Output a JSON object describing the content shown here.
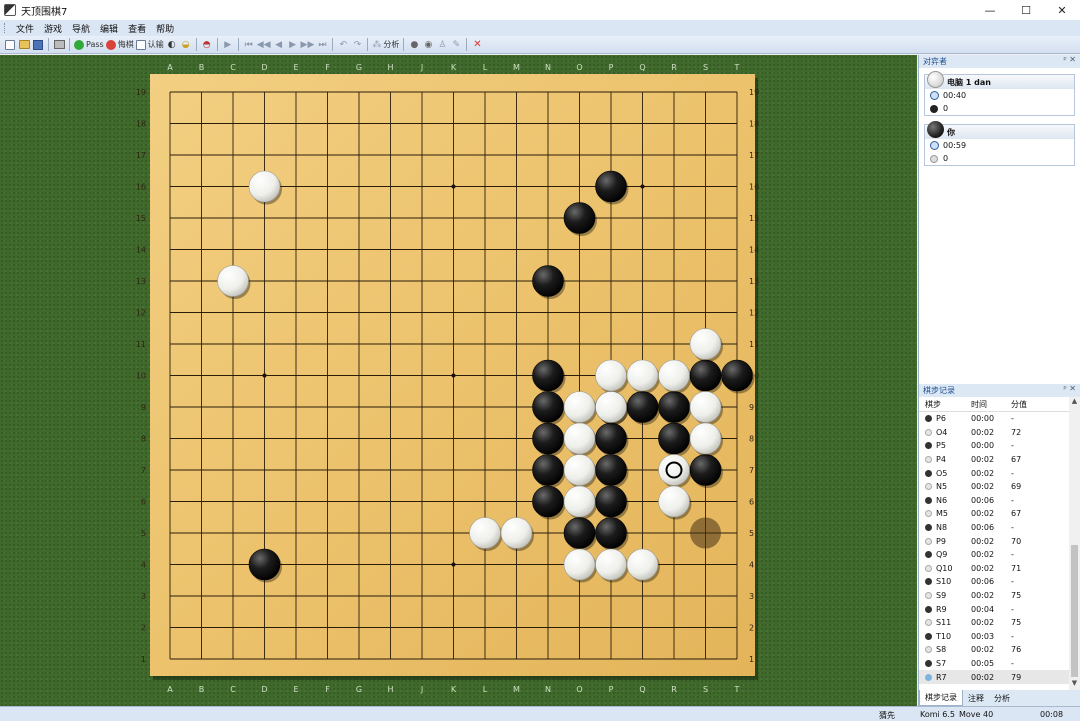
{
  "window": {
    "title": "天顶围棋7",
    "minimize": "—",
    "maximize": "☐",
    "close": "✕"
  },
  "menu": [
    "文件",
    "游戏",
    "导航",
    "编辑",
    "查看",
    "帮助"
  ],
  "toolbar": {
    "pass": "Pass",
    "undo": "悔棋",
    "resign": "认输",
    "analyze": "分析"
  },
  "board": {
    "size": 19,
    "columns": [
      "A",
      "B",
      "C",
      "D",
      "E",
      "F",
      "G",
      "H",
      "J",
      "K",
      "L",
      "M",
      "N",
      "O",
      "P",
      "Q",
      "R",
      "S",
      "T"
    ],
    "black_stones": [
      "P16",
      "O15",
      "N13",
      "N10",
      "N9",
      "N8",
      "N7",
      "N6",
      "P9",
      "Q9",
      "R9",
      "S10",
      "T10",
      "P8",
      "R8",
      "P7",
      "S7",
      "P6",
      "O5",
      "P5",
      "D4"
    ],
    "white_stones": [
      "D16",
      "C13",
      "S11",
      "P10",
      "Q10",
      "R10",
      "O9",
      "P9w",
      "S9",
      "O8",
      "S8",
      "O7",
      "R7",
      "O6",
      "R6",
      "L5",
      "M5",
      "O4",
      "P4",
      "Q4"
    ],
    "last_move": "R7",
    "ghost_stone": "S5"
  },
  "players_panel": {
    "title": "对弈者",
    "white": {
      "name": "电脑 1 dan",
      "time": "00:40",
      "captures": "0"
    },
    "black": {
      "name": "你",
      "time": "00:59",
      "captures": "0"
    }
  },
  "move_log": {
    "title": "棋步记录",
    "headers": [
      "棋步",
      "时间",
      "分值"
    ],
    "rows": [
      {
        "color": "black",
        "move": "P6",
        "time": "00:00",
        "score": "-"
      },
      {
        "color": "white",
        "move": "O4",
        "time": "00:02",
        "score": "72"
      },
      {
        "color": "black",
        "move": "P5",
        "time": "00:00",
        "score": "-"
      },
      {
        "color": "white",
        "move": "P4",
        "time": "00:02",
        "score": "67"
      },
      {
        "color": "black",
        "move": "O5",
        "time": "00:02",
        "score": "-"
      },
      {
        "color": "white",
        "move": "N5",
        "time": "00:02",
        "score": "69"
      },
      {
        "color": "black",
        "move": "N6",
        "time": "00:06",
        "score": "-"
      },
      {
        "color": "white",
        "move": "M5",
        "time": "00:02",
        "score": "67"
      },
      {
        "color": "black",
        "move": "N8",
        "time": "00:06",
        "score": "-"
      },
      {
        "color": "white",
        "move": "P9",
        "time": "00:02",
        "score": "70"
      },
      {
        "color": "black",
        "move": "Q9",
        "time": "00:02",
        "score": "-"
      },
      {
        "color": "white",
        "move": "Q10",
        "time": "00:02",
        "score": "71"
      },
      {
        "color": "black",
        "move": "S10",
        "time": "00:06",
        "score": "-"
      },
      {
        "color": "white",
        "move": "S9",
        "time": "00:02",
        "score": "75"
      },
      {
        "color": "black",
        "move": "R9",
        "time": "00:04",
        "score": "-"
      },
      {
        "color": "white",
        "move": "S11",
        "time": "00:02",
        "score": "75"
      },
      {
        "color": "black",
        "move": "T10",
        "time": "00:03",
        "score": "-"
      },
      {
        "color": "white",
        "move": "S8",
        "time": "00:02",
        "score": "76"
      },
      {
        "color": "black",
        "move": "S7",
        "time": "00:05",
        "score": "-"
      },
      {
        "color": "blue",
        "move": "R7",
        "time": "00:02",
        "score": "79"
      }
    ],
    "tabs": [
      "棋步记录",
      "注释",
      "分析"
    ]
  },
  "status": {
    "turn": "猜先",
    "komi": "Komi 6.5",
    "move": "Move 40",
    "time": "00:08"
  }
}
